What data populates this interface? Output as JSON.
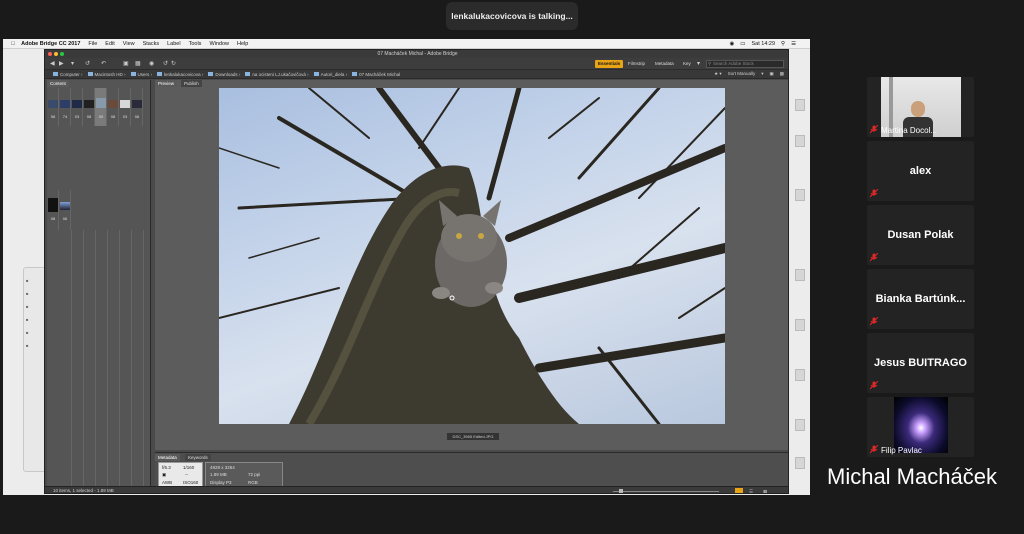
{
  "banner": {
    "text": "lenkalukacovicova is talking..."
  },
  "menubar": {
    "app": "Adobe Bridge CC 2017",
    "items": [
      "File",
      "Edit",
      "View",
      "Stacks",
      "Label",
      "Tools",
      "Window",
      "Help"
    ],
    "clock": "Sat 14:29"
  },
  "bridge": {
    "title": "07 Macháček Michal - Adobe Bridge",
    "workspaces": [
      "Essentials",
      "Filmstrip",
      "Metadata",
      "Key"
    ],
    "search_placeholder": "Search Adobe Stock",
    "breadcrumb": [
      "Computer",
      "Macintosh HD",
      "Users",
      "lenkalukacovicova",
      "Downloads",
      "na ocisteni LJ.ukačovičová",
      "Autori_diela",
      "07 Macháček Michal"
    ],
    "sort_label": "Sort Manually",
    "panels": {
      "content": "Content",
      "preview": "Preview",
      "publish": "Publish",
      "metadata": "Metadata",
      "keywords": "Keywords"
    },
    "thumbs_row1": [
      "58",
      "74",
      "03",
      "08",
      "05",
      "08",
      "03",
      "06",
      "08"
    ],
    "thumbs_row2": [
      "08",
      "06"
    ],
    "filename": "DSC_3965 Edited.JPG",
    "meta": {
      "aperture": "f/6.3",
      "shutter": "1/160",
      "dash": "--",
      "awb": "AWB",
      "iso": "ISO160",
      "dimensions": "4928 x 3264",
      "size": "1.89 MB",
      "ppi": "72 ppi",
      "profile": "Display P3",
      "mode": "RGB"
    },
    "status": "10 items, 1 selected - 1.89 MB"
  },
  "participants": [
    {
      "name": "Martina Docol...",
      "video": true
    },
    {
      "name": "alex",
      "video": false
    },
    {
      "name": "Dusan Polak",
      "video": false
    },
    {
      "name": "Bianka Bartúnk...",
      "video": false
    },
    {
      "name": "Jesus BUITRAGO",
      "video": false
    },
    {
      "name": "Filip Pavlac",
      "video": true
    }
  ],
  "active_speaker": "Michal Macháček",
  "colors": {
    "accent": "#e8a317",
    "mic_muted": "#e02828"
  }
}
